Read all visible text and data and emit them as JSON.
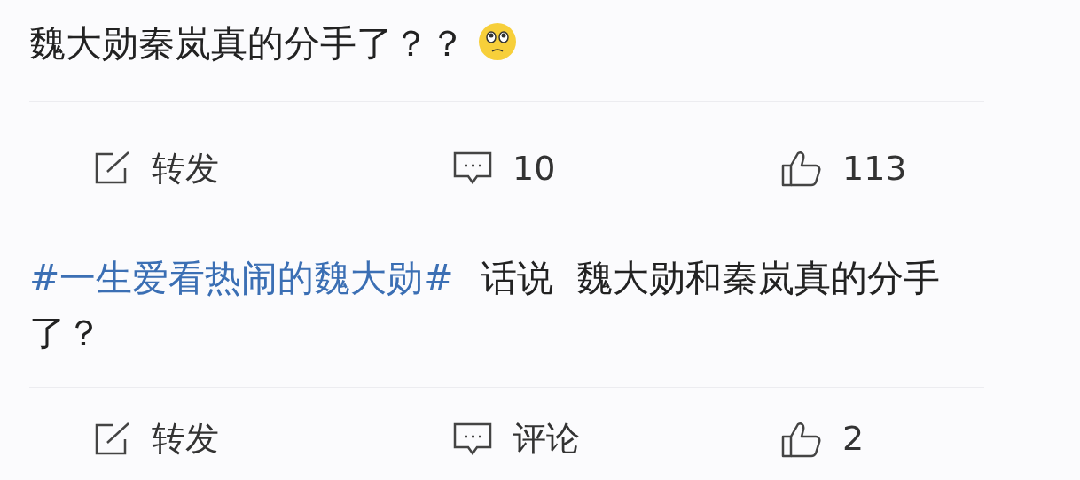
{
  "posts": [
    {
      "text": "魏大勋秦岚真的分手了？？",
      "actions": [
        {
          "kind": "repost",
          "label": "转发"
        },
        {
          "kind": "comment",
          "label": "10"
        },
        {
          "kind": "like",
          "label": "113"
        }
      ]
    },
    {
      "hashtag": "#一生爱看热闹的魏大勋#",
      "text": "话说  魏大勋和秦岚真的分手了？",
      "actions": [
        {
          "kind": "repost",
          "label": "转发"
        },
        {
          "kind": "comment",
          "label": "评论"
        },
        {
          "kind": "like",
          "label": "2"
        }
      ]
    }
  ]
}
